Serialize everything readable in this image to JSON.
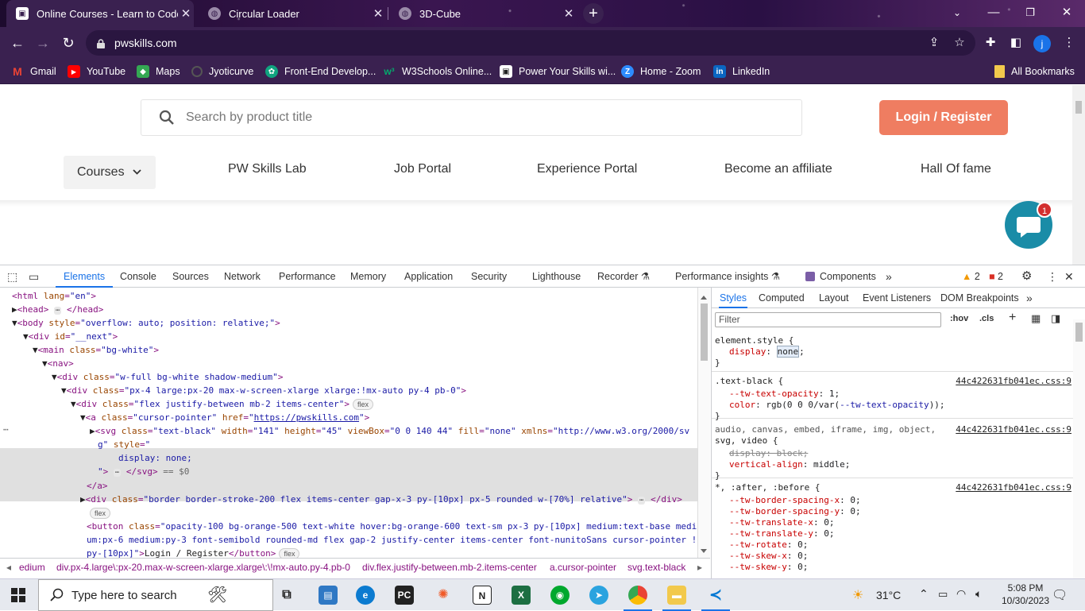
{
  "browser": {
    "tabs": [
      {
        "title": "Online Courses - Learn to Code ..."
      },
      {
        "title": "Circular Loader"
      },
      {
        "title": "3D-Cube"
      }
    ],
    "url": "pwskills.com",
    "profile_initial": "j",
    "bookmarks": [
      {
        "label": "Gmail"
      },
      {
        "label": "YouTube"
      },
      {
        "label": "Maps"
      },
      {
        "label": "Jyoticurve"
      },
      {
        "label": "Front-End Develop..."
      },
      {
        "label": "W3Schools Online..."
      },
      {
        "label": "Power Your Skills wi..."
      },
      {
        "label": "Home - Zoom"
      },
      {
        "label": "LinkedIn"
      }
    ],
    "all_bookmarks": "All Bookmarks"
  },
  "page": {
    "search_placeholder": "Search by product title",
    "login_label": "Login / Register",
    "nav": [
      "Courses",
      "PW Skills Lab",
      "Job Portal",
      "Experience Portal",
      "Become an affiliate",
      "Hall Of fame"
    ],
    "chat_badge": "1"
  },
  "devtools": {
    "tabs": [
      "Elements",
      "Console",
      "Sources",
      "Network",
      "Performance",
      "Memory",
      "Application",
      "Security",
      "Lighthouse",
      "Recorder",
      "Performance insights",
      "Components"
    ],
    "warnings": "2",
    "errors": "2",
    "styles_tabs": [
      "Styles",
      "Computed",
      "Layout",
      "Event Listeners",
      "DOM Breakpoints"
    ],
    "filter_placeholder": "Filter",
    "hov": ":hov",
    "cls": ".cls",
    "breadcrumbs": [
      "edium",
      "div.px-4.large\\:px-20.max-w-screen-xlarge.xlarge\\:\\!mx-auto.py-4.pb-0",
      "div.flex.justify-between.mb-2.items-center",
      "a.cursor-pointer",
      "svg.text-black"
    ],
    "source_file": "44c422631fb041ec.css:9",
    "flex_badge": "flex"
  },
  "taskbar": {
    "search_text": "Type here to search",
    "temperature": "31°C",
    "time": "5:08 PM",
    "date": "10/30/2023"
  }
}
